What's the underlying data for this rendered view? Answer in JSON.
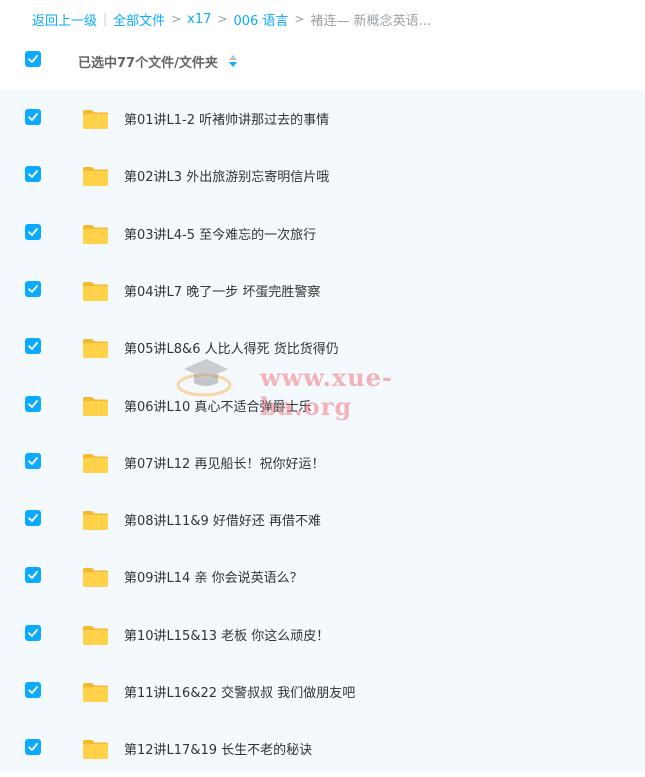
{
  "breadcrumb": {
    "back": "返回上一级",
    "all_files": "全部文件",
    "level1": "x17",
    "level2": "006 语言",
    "current": "褚连— 新概念英语..."
  },
  "header": {
    "selection_text": "已选中77个文件/文件夹"
  },
  "rows": [
    {
      "name": "第01讲L1-2 听褚帅讲那过去的事情"
    },
    {
      "name": "第02讲L3 外出旅游别忘寄明信片哦"
    },
    {
      "name": "第03讲L4-5 至今难忘的一次旅行"
    },
    {
      "name": "第04讲L7 晚了一步 坏蛋完胜警察"
    },
    {
      "name": "第05讲L8&6 人比人得死 货比货得仍"
    },
    {
      "name": "第06讲L10 真心不适合弹爵士乐"
    },
    {
      "name": "第07讲L12 再见船长！祝你好运！"
    },
    {
      "name": "第08讲L11&9 好借好还 再借不难"
    },
    {
      "name": "第09讲L14 亲 你会说英语么？"
    },
    {
      "name": "第10讲L15&13 老板 你这么顽皮！"
    },
    {
      "name": "第11讲L16&22 交警叔叔 我们做朋友吧"
    },
    {
      "name": "第12讲L17&19 长生不老的秘诀"
    }
  ],
  "watermark": {
    "text": "www.xue-ba.org"
  },
  "colors": {
    "accent": "#09aaff",
    "folder": "#ffcb3d",
    "list_bg": "#f3f9fd"
  }
}
